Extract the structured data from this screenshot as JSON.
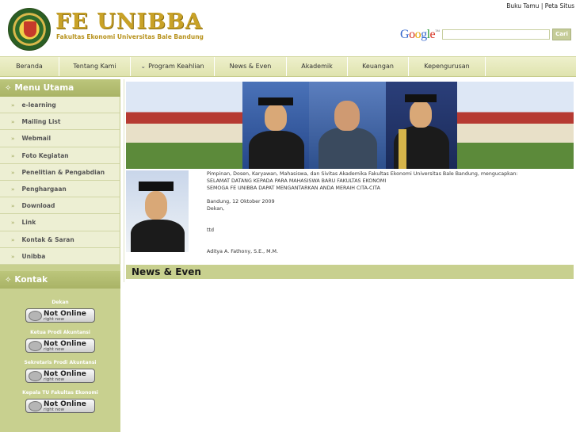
{
  "header": {
    "top_links": [
      "Buku Tamu",
      "Peta Situs"
    ],
    "site_title": "FE UNIBBA",
    "site_subtitle": "Fakultas Ekonomi Universitas Bale Bandung",
    "search_brand": "Google",
    "search_placeholder": "",
    "search_button": "Cari"
  },
  "nav": [
    {
      "label": "Beranda"
    },
    {
      "label": "Tentang Kami"
    },
    {
      "label": "Program Keahlian",
      "has_chevron": true
    },
    {
      "label": "News & Even"
    },
    {
      "label": "Akademik"
    },
    {
      "label": "Keuangan"
    },
    {
      "label": "Kepengurusan"
    }
  ],
  "sidebar": {
    "menu_title": "Menu Utama",
    "menu_items": [
      "e-learning",
      "Mailing List",
      "Webmail",
      "Foto Kegiatan",
      "Penelitian & Pengabdian",
      "Penghargaan",
      "Download",
      "Link",
      "Kontak & Saran",
      "Unibba"
    ],
    "contact_title": "Kontak",
    "contacts": [
      {
        "role": "Dekan",
        "status": "Not Online",
        "sub": "right now"
      },
      {
        "role": "Ketua Prodi Akuntansi",
        "status": "Not Online",
        "sub": "right now"
      },
      {
        "role": "Sekretaris Prodi Akuntansi",
        "status": "Not Online",
        "sub": "right now"
      },
      {
        "role": "Kepala TU Fakultas Ekonomi",
        "status": "Not Online",
        "sub": "right now"
      }
    ]
  },
  "message": {
    "line1": "Pimpinan, Dosen, Karyawan, Mahasiswa, dan Sivitas Akademika Fakultas Ekonomi Universitas Bale Bandung, mengucapkan:",
    "line2": "SELAMAT DATANG KEPADA PARA MAHASISWA BARU FAKULTAS EKONOMI",
    "line3": "SEMOGA FE UNIBBA DAPAT MENGANTARKAN ANDA MERAIH CITA-CITA",
    "date": "Bandung, 12 Oktober 2009",
    "position": "Dekan,",
    "signature": "ttd",
    "name": "Aditya A. Fathony, S.E., M.M."
  },
  "news_title": "News & Even"
}
